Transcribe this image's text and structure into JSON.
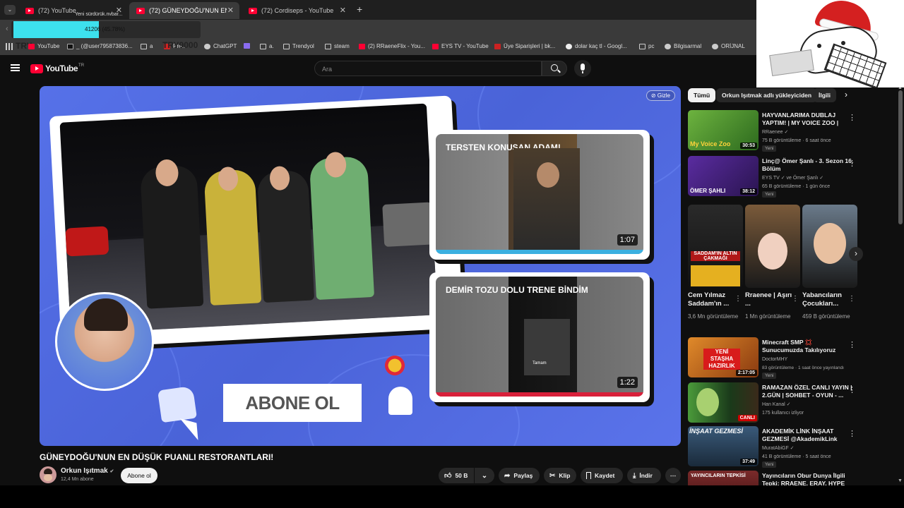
{
  "browser": {
    "tabs": [
      {
        "label": "(72) YouTube",
        "active": false
      },
      {
        "label": "(72) GÜNEYDOĞU'NUN EN DÜŞ",
        "active": true
      },
      {
        "label": "(72) Cordiseps - YouTube",
        "active": false
      }
    ],
    "new_tab": "+",
    "progress_text": "41206 (45.78%)",
    "progress_percent": 45.78,
    "overlay_text": "Yeni sürdürük.nvbar...",
    "bookmarks": [
      "YouTube",
      "_ (@user795873836...",
      "a",
      "Pre...",
      "ChatGPT",
      "a.",
      "Trendyol",
      "steam",
      "(2) RRaeneFlix - You...",
      "EYS TV - YouTube",
      "Üye Siparişleri | bk...",
      "dolar kaç tl - Googl...",
      "pc",
      "Bilgisarmal",
      "ORİJNAL"
    ],
    "try_label": "TRY",
    "try_value": "TRY9000"
  },
  "youtube": {
    "logo": "YouTube",
    "logo_region": "TR",
    "search_placeholder": "Ara",
    "player": {
      "hide_label": "Gizle",
      "card1_title": "TERSTEN KONUŞAN ADAM!",
      "card1_duration": "1:07",
      "card2_title": "DEMİR TOZU DOLU TRENE BİNDİM",
      "card2_duration": "1:22",
      "subscribe_art": "ABONE OL",
      "card2_inner": "Tamam"
    },
    "video_title": "GÜNEYDOĞU'NUN EN DÜŞÜK PUANLI RESTORANTLARI!",
    "channel": {
      "name": "Orkun Işıtmak",
      "subs": "12,4 Mn abone",
      "subscribe": "Abone ol"
    },
    "actions": {
      "likes": "50 B",
      "share": "Paylaş",
      "clip": "Klip",
      "save": "Kaydet",
      "download": "İndir",
      "more": "⋯"
    },
    "chips": [
      "Tümü",
      "Orkun Işıtmak adlı yükleyiciden",
      "İlgili"
    ],
    "recs": [
      {
        "title": "HAYVANLARIMA DUBLAJ YAPTIM! | MY VOICE ZOO |",
        "channel": "RRaenee ✓",
        "meta": "75 B görüntüleme · 6 saat önce",
        "badge": "Yeni",
        "duration": "30:53",
        "color": "#4a8a2e"
      },
      {
        "title": "Linç@ Ömer Şanlı - 3. Sezon 16. Bölüm",
        "channel": "EYS TV ✓ ve Ömer Şanlı ✓",
        "meta": "65 B görüntüleme · 1 gün önce",
        "badge": "Yeni",
        "duration": "38:12",
        "color": "#4a2a8a"
      }
    ],
    "shorts": [
      {
        "title": "Cem Yılmaz Saddam'ın ...",
        "views": "3,6 Mn görüntüleme",
        "overlay": "SADDAM'IN ALTIN ÇAKMAĞI"
      },
      {
        "title": "Rraenee | Aşırı ...",
        "views": "1 Mn görüntüleme",
        "overlay": ""
      },
      {
        "title": "Yabancıların Çocukları...",
        "views": "459 B görüntüleme",
        "overlay": ""
      }
    ],
    "recs2": [
      {
        "title": "Minecraft SMP 💢 Sunucumuzda Takılıyoruz",
        "channel": "DoctorMHY",
        "meta": "83 görüntüleme · 1 saat önce yayınlandı",
        "badge": "Yeni",
        "duration": "2:17:05",
        "color": "#c46a1e"
      },
      {
        "title": "RAMAZAN ÖZEL CANLI YAYIN | 2.GÜN | SOHBET - OYUN - ...",
        "channel": "Han Kanal ✓",
        "meta": "175 kullanıcı izliyor",
        "badge": "",
        "duration": "CANLI",
        "color": "#2e7d32"
      },
      {
        "title": "AKADEMİK LİNK İNŞAAT GEZMESİ @AkademikLink",
        "channel": "MuratAbiGF ✓",
        "meta": "41 B görüntüleme · 5 saat önce",
        "badge": "Yeni",
        "duration": "37:49",
        "color": "#345"
      },
      {
        "title": "Yayıncıların Obur Dunya İlgili Tepki: RRAENE, ERAY, HYPE",
        "channel": "",
        "meta": "",
        "badge": "",
        "duration": "",
        "color": "#7a2a2a"
      }
    ],
    "thumb_texts": {
      "rec1": "My Voice Zoo",
      "rec2": "ÖMER ŞAHLI",
      "rec3": "YENİ STAŞHA HAZIRLIK",
      "rec5": "İNŞAAT GEZMESİ",
      "rec6": "YAYINCILARIN TEPKİSİ"
    }
  }
}
